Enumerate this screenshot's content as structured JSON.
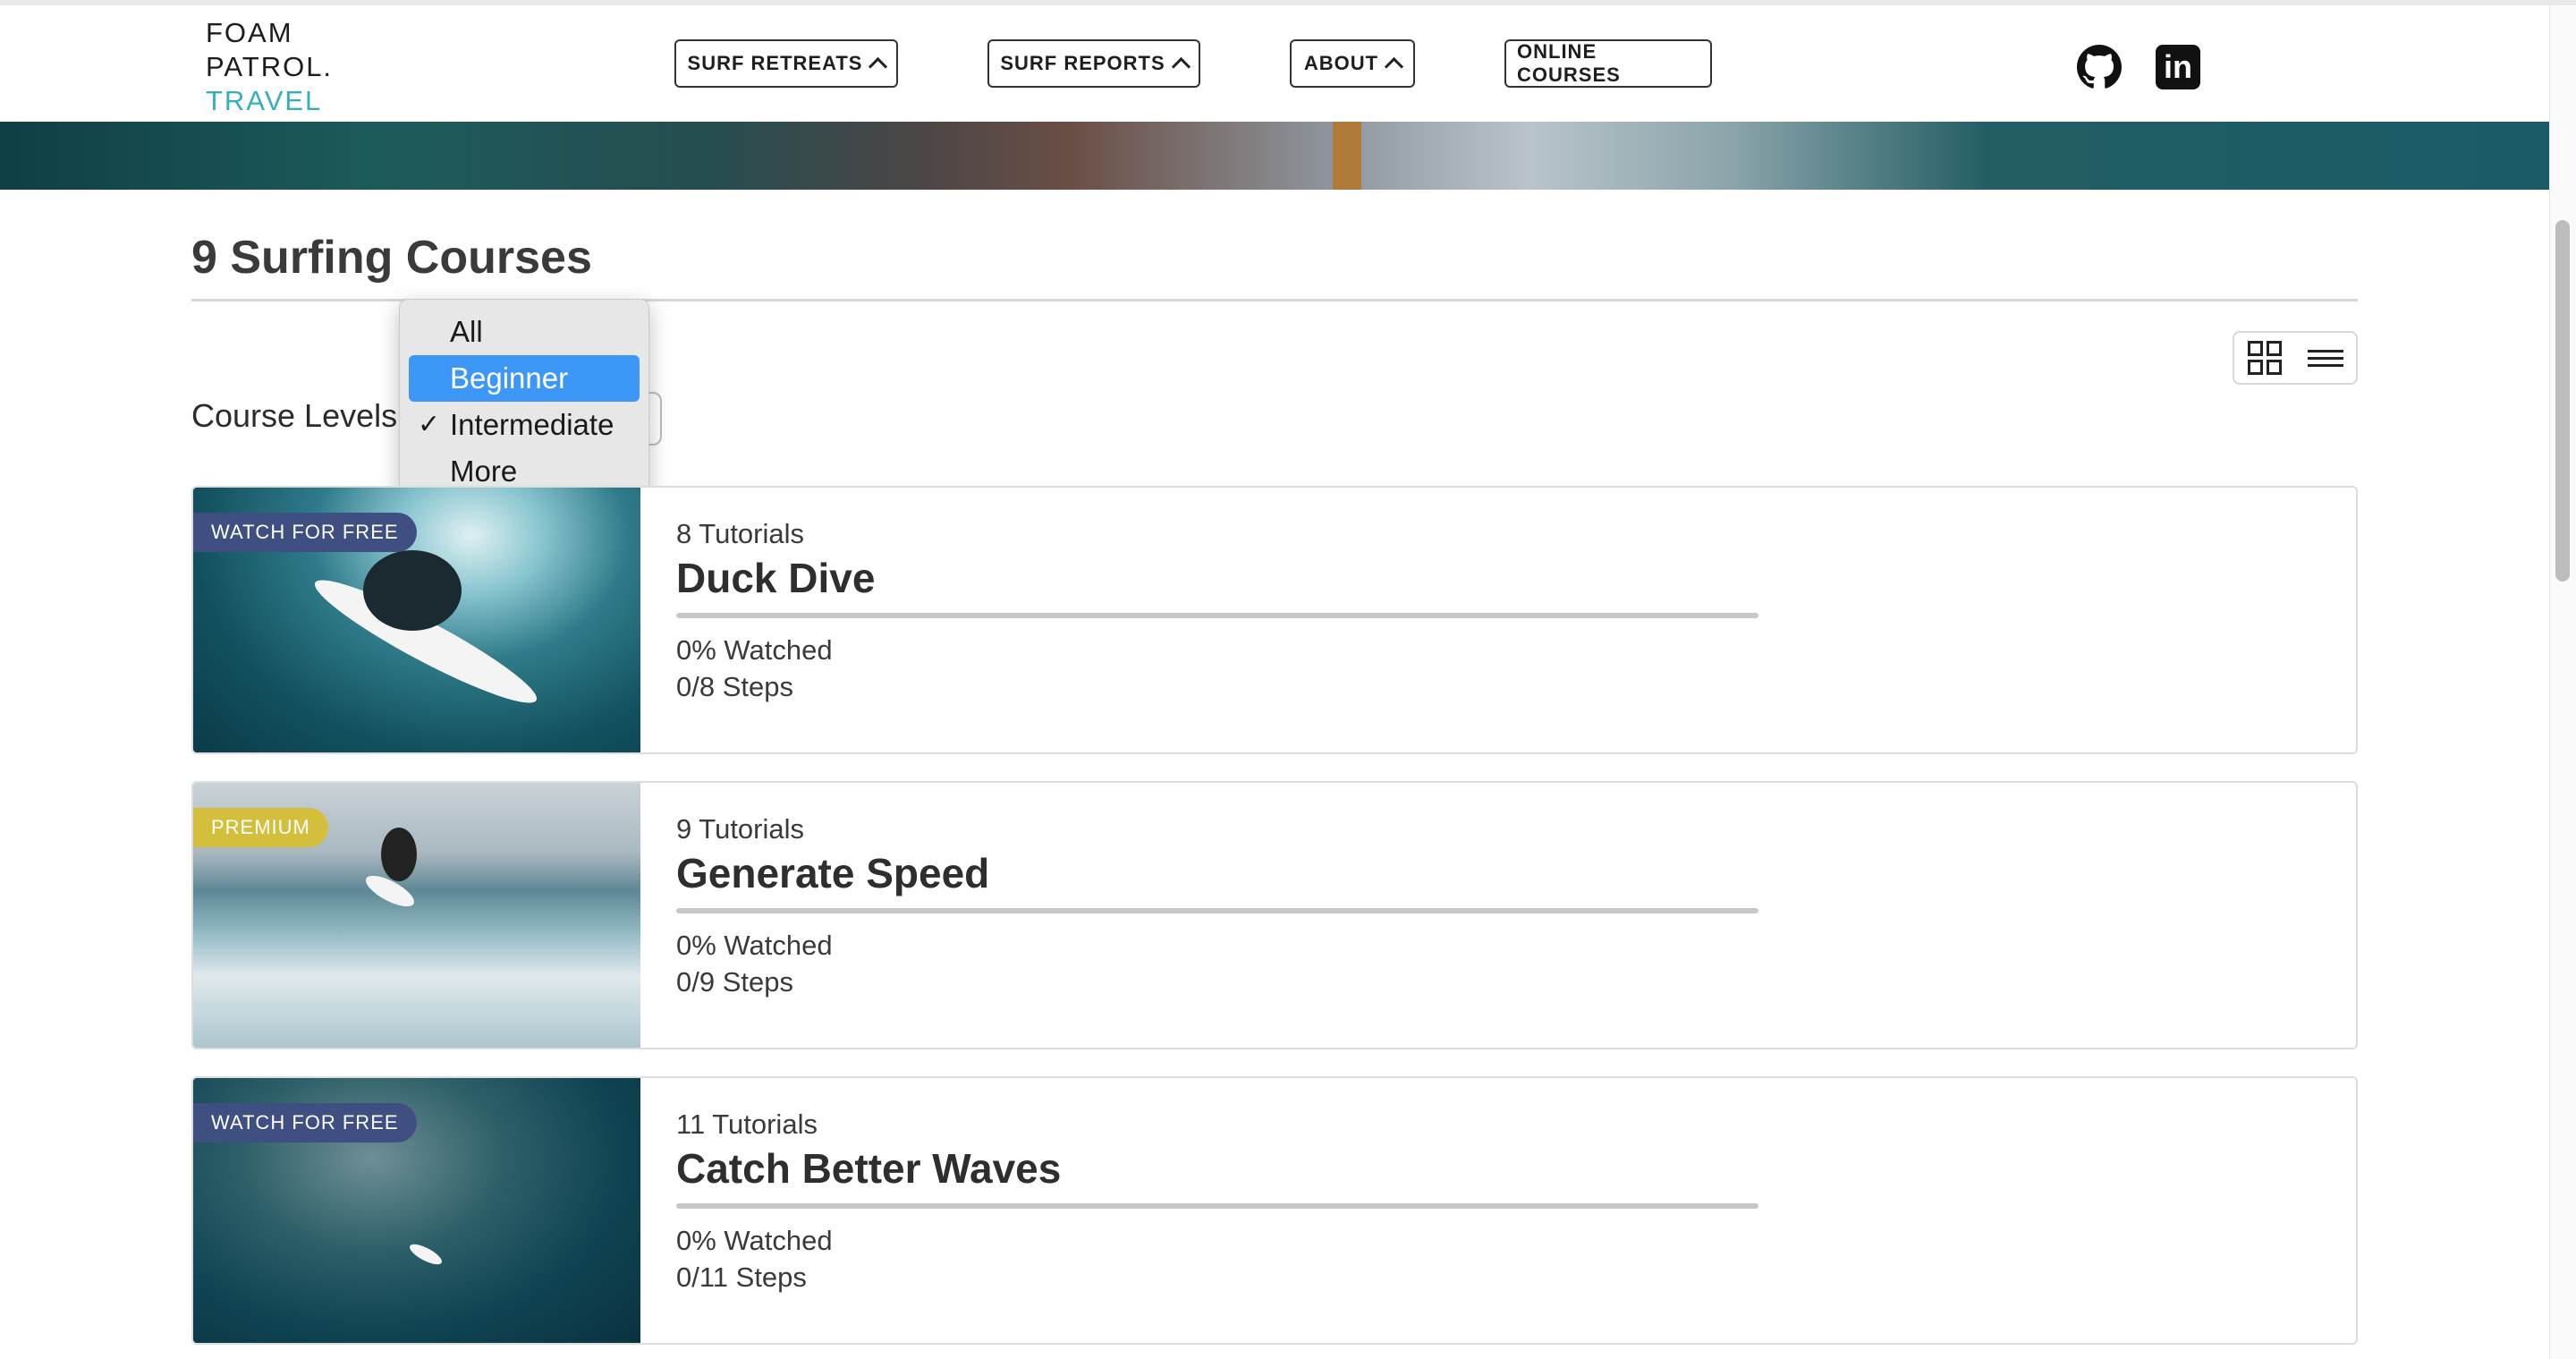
{
  "header": {
    "logo": {
      "line1": "FOAM",
      "line2": "PATROL.",
      "line3": "TRAVEL"
    },
    "nav": [
      {
        "label": "SURF RETREATS"
      },
      {
        "label": "SURF REPORTS"
      },
      {
        "label": "ABOUT"
      },
      {
        "label": "ONLINE COURSES"
      }
    ],
    "social": {
      "github_icon": "github-icon",
      "linkedin_icon": "linkedin-icon",
      "linkedin_text": "in"
    }
  },
  "main": {
    "title": "9 Surfing Courses",
    "levels_label": "Course Levels",
    "view_toggle": [
      "grid-view-icon",
      "list-view-icon"
    ]
  },
  "level_dropdown": {
    "options": [
      "All",
      "Beginner",
      "Intermediate",
      "More"
    ],
    "highlighted": "Beginner",
    "checked": "Intermediate",
    "check_mark": "✓"
  },
  "courses": [
    {
      "badge": "WATCH FOR FREE",
      "tutorials": "8 Tutorials",
      "title": "Duck Dive",
      "watched": "0% Watched",
      "steps": "0/8 Steps",
      "progress": 0
    },
    {
      "badge": "PREMIUM",
      "tutorials": "9 Tutorials",
      "title": "Generate Speed",
      "watched": "0% Watched",
      "steps": "0/9 Steps",
      "progress": 0
    },
    {
      "badge": "WATCH FOR FREE",
      "tutorials": "11 Tutorials",
      "title": "Catch Better Waves",
      "watched": "0% Watched",
      "steps": "0/11 Steps",
      "progress": 0
    }
  ],
  "colors": {
    "accent": "#33b0b8",
    "free_badge": "#3f4f82",
    "premium_badge": "#d4bf3c",
    "dropdown_highlight": "#3d97f7"
  }
}
